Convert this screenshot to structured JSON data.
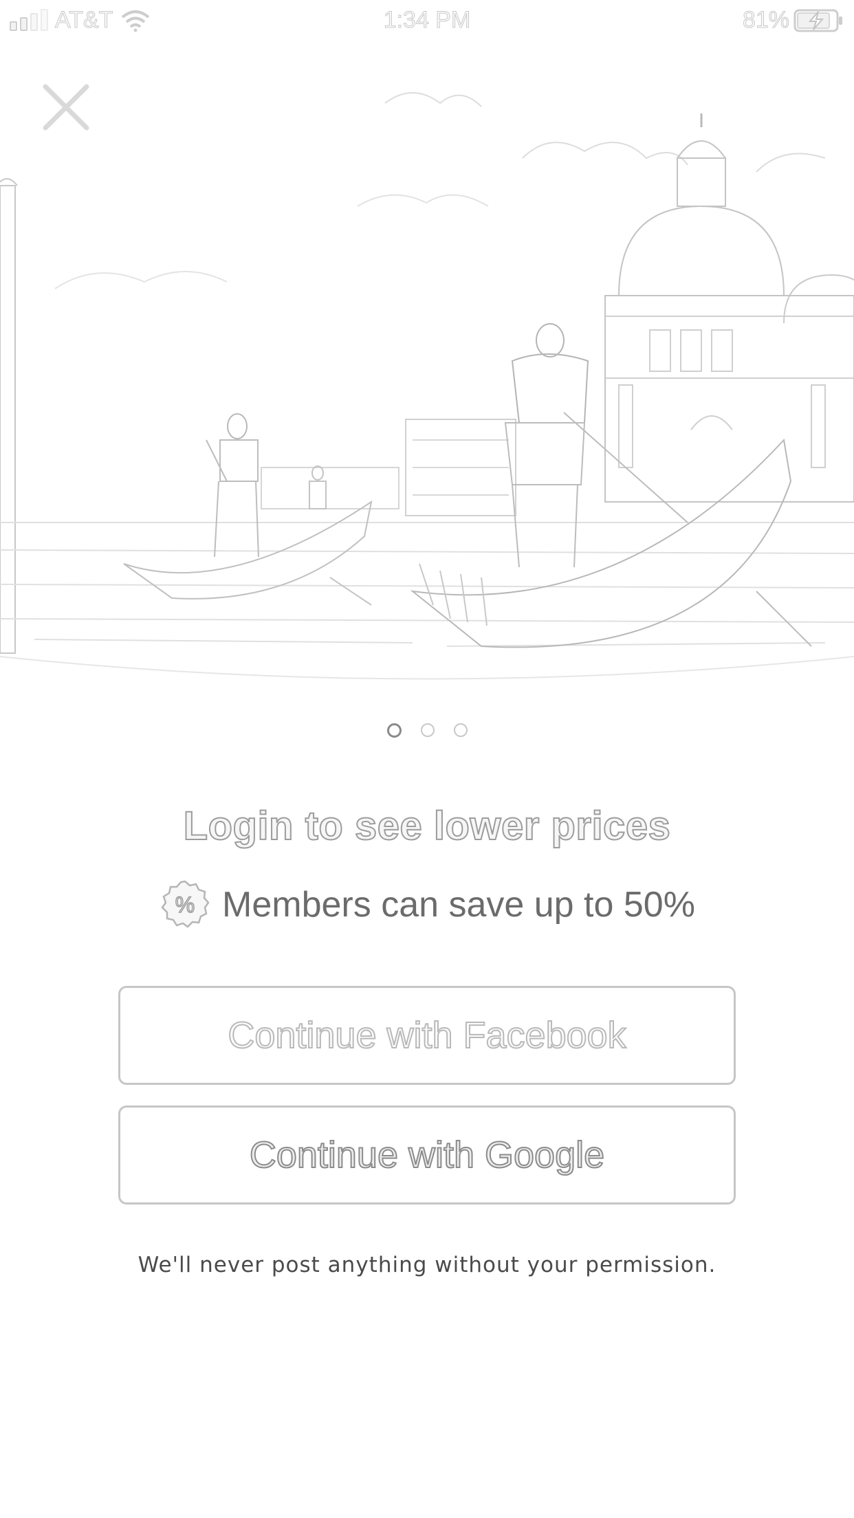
{
  "status_bar": {
    "carrier": "AT&T",
    "time": "1:34 PM",
    "battery_percent": "81%",
    "icons": [
      "signal-icon",
      "wifi-icon",
      "battery-charging-icon"
    ]
  },
  "close_icon": "close-icon",
  "hero": {
    "scene": "gondolas-venice-photo",
    "page_indicator": {
      "count": 3,
      "active_index": 0
    }
  },
  "headline": "Login to see lower prices",
  "savings": {
    "icon": "percent-badge-icon",
    "text": "Members can save up to 50%"
  },
  "buttons": {
    "facebook": "Continue with Facebook",
    "google": "Continue with Google"
  },
  "disclaimer": "We'll never post anything without your permission."
}
